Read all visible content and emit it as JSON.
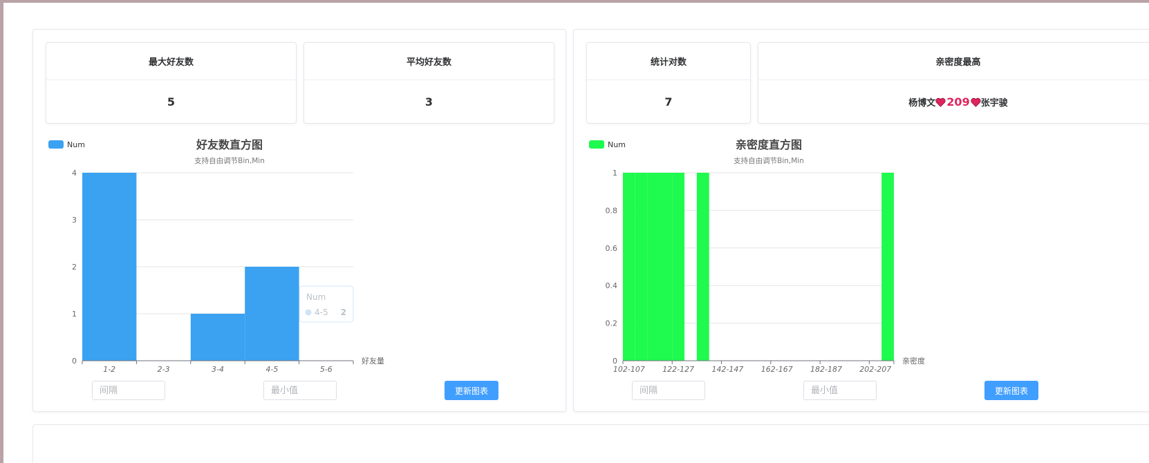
{
  "left_panel": {
    "stats": [
      {
        "title": "最大好友数",
        "value": "5"
      },
      {
        "title": "平均好友数",
        "value": "3"
      }
    ],
    "controls": {
      "interval_placeholder": "间隔",
      "min_placeholder": "最小值",
      "update_label": "更新图表"
    }
  },
  "right_panel": {
    "stats": [
      {
        "title": "统计对数",
        "value": "7"
      },
      {
        "title": "亲密度最高",
        "pair": {
          "name_a": "杨博文",
          "score": "209",
          "name_b": "张宇骏"
        }
      }
    ],
    "controls": {
      "interval_placeholder": "间隔",
      "min_placeholder": "最小值",
      "update_label": "更新图表"
    }
  },
  "chart_data": [
    {
      "type": "bar",
      "title": "好友数直方图",
      "subtitle": "支持自由调节Bin,Min",
      "xlabel": "好友量",
      "ylabel": "",
      "categories": [
        "1-2",
        "2-3",
        "3-4",
        "4-5",
        "5-6"
      ],
      "series": [
        {
          "name": "Num",
          "values": [
            4,
            0,
            1,
            2,
            0
          ],
          "color": "#3ba2f2"
        }
      ],
      "ylim": [
        0,
        4
      ],
      "yticks": [
        "0",
        "1",
        "2",
        "3",
        "4"
      ],
      "legend": "top-left",
      "grid": true,
      "tooltip": {
        "series": "Num",
        "category": "4-5",
        "value": "2"
      }
    },
    {
      "type": "bar",
      "title": "亲密度直方图",
      "subtitle": "支持自由调节Bin,Min",
      "xlabel": "亲密度",
      "ylabel": "",
      "bins_start": 102,
      "bin_width": 5,
      "series": [
        {
          "name": "Num",
          "values": [
            1,
            1,
            1,
            1,
            1,
            0,
            1,
            0,
            0,
            0,
            0,
            0,
            0,
            0,
            0,
            0,
            0,
            0,
            0,
            0,
            0,
            1
          ],
          "color": "#1efa4e"
        }
      ],
      "tick_labels": [
        "102-107",
        "122-127",
        "142-147",
        "162-167",
        "182-187",
        "202-207"
      ],
      "ylim": [
        0,
        1
      ],
      "yticks": [
        "0",
        "0.2",
        "0.4",
        "0.6",
        "0.8",
        "1"
      ],
      "legend": "top-left",
      "grid": true
    }
  ]
}
